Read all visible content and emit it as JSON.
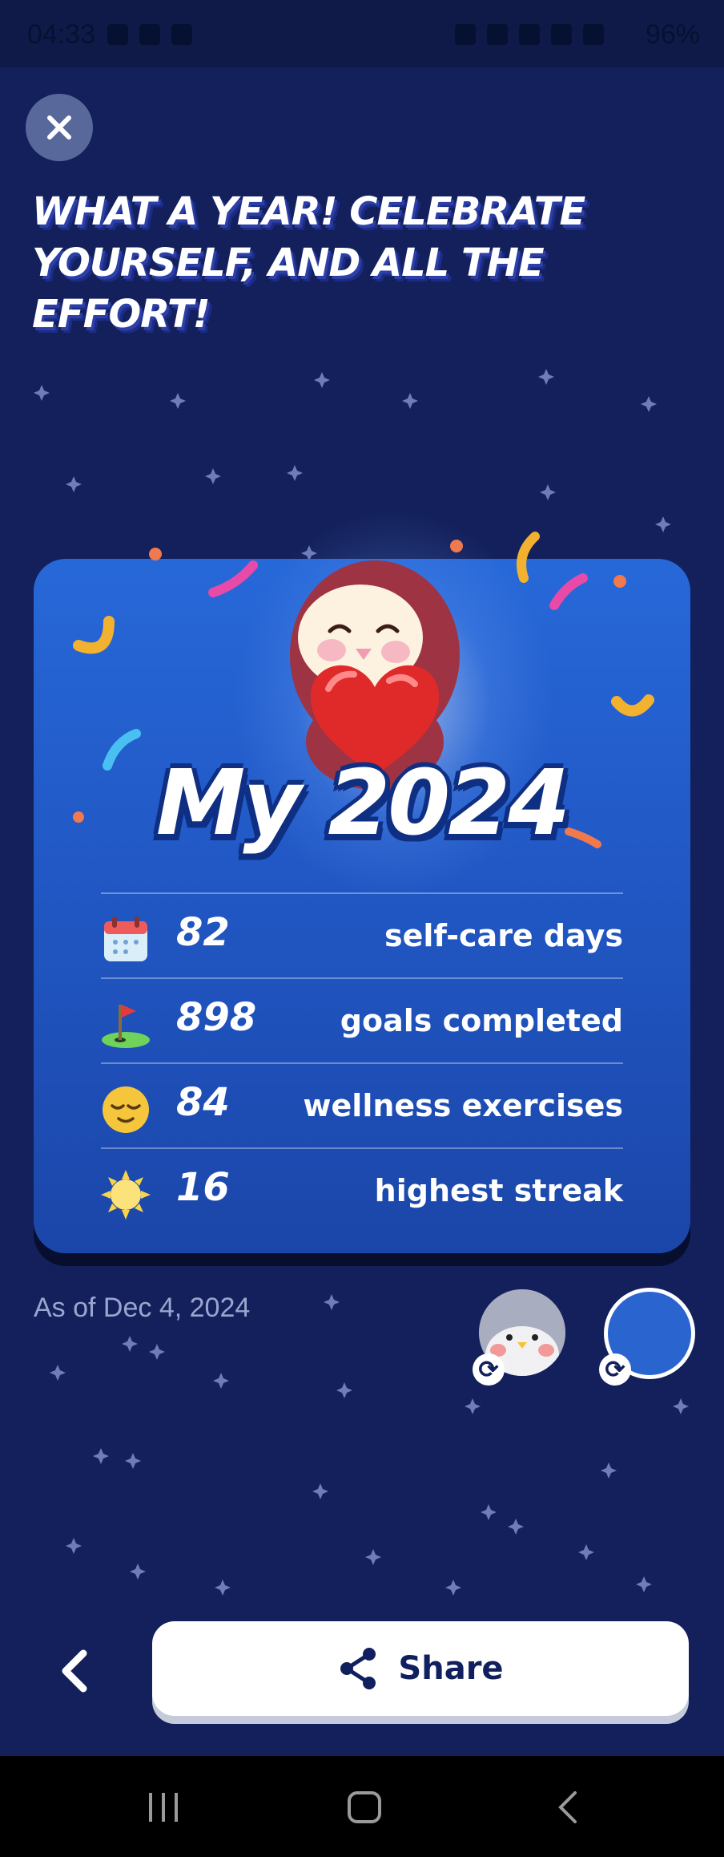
{
  "status_bar": {
    "time": "04:33",
    "battery": "96%",
    "left_icons": [
      "image-icon",
      "task-icon",
      "snowman-icon"
    ],
    "right_icons": [
      "key-icon",
      "battery-saver-icon",
      "mute-icon",
      "wifi-icon",
      "signal-icon"
    ]
  },
  "headline": "WHAT A YEAR! CELEBRATE YOURSELF, AND ALL THE EFFORT!",
  "card": {
    "title": "My 2024",
    "stats": [
      {
        "icon": "calendar-icon",
        "value": "82",
        "label": "self-care days"
      },
      {
        "icon": "golf-flag-icon",
        "value": "898",
        "label": "goals completed"
      },
      {
        "icon": "relieved-face-icon",
        "value": "84",
        "label": "wellness exercises"
      },
      {
        "icon": "sun-icon",
        "value": "16",
        "label": "highest streak"
      }
    ]
  },
  "as_of": "As of Dec 4, 2024",
  "share_label": "Share",
  "colors": {
    "background": "#13205c",
    "card": "#2361d1",
    "swatch": "#2a64cf"
  }
}
